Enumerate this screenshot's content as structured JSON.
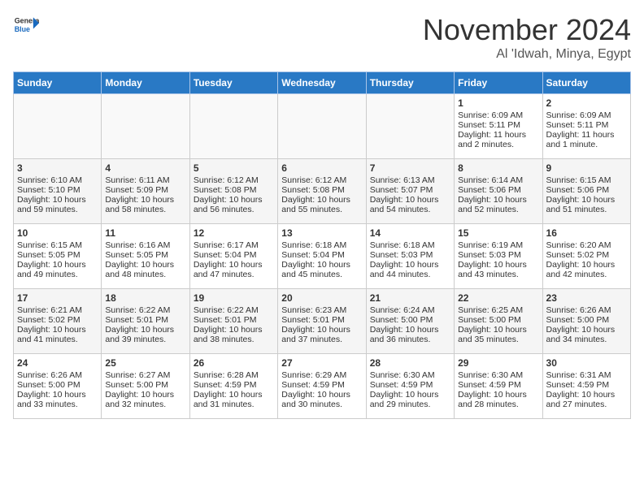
{
  "header": {
    "logo_general": "General",
    "logo_blue": "Blue",
    "month_title": "November 2024",
    "location": "Al 'Idwah, Minya, Egypt"
  },
  "days_of_week": [
    "Sunday",
    "Monday",
    "Tuesday",
    "Wednesday",
    "Thursday",
    "Friday",
    "Saturday"
  ],
  "weeks": [
    [
      {
        "day": "",
        "data": ""
      },
      {
        "day": "",
        "data": ""
      },
      {
        "day": "",
        "data": ""
      },
      {
        "day": "",
        "data": ""
      },
      {
        "day": "",
        "data": ""
      },
      {
        "day": "1",
        "data": "Sunrise: 6:09 AM\nSunset: 5:11 PM\nDaylight: 11 hours and 2 minutes."
      },
      {
        "day": "2",
        "data": "Sunrise: 6:09 AM\nSunset: 5:11 PM\nDaylight: 11 hours and 1 minute."
      }
    ],
    [
      {
        "day": "3",
        "data": "Sunrise: 6:10 AM\nSunset: 5:10 PM\nDaylight: 10 hours and 59 minutes."
      },
      {
        "day": "4",
        "data": "Sunrise: 6:11 AM\nSunset: 5:09 PM\nDaylight: 10 hours and 58 minutes."
      },
      {
        "day": "5",
        "data": "Sunrise: 6:12 AM\nSunset: 5:08 PM\nDaylight: 10 hours and 56 minutes."
      },
      {
        "day": "6",
        "data": "Sunrise: 6:12 AM\nSunset: 5:08 PM\nDaylight: 10 hours and 55 minutes."
      },
      {
        "day": "7",
        "data": "Sunrise: 6:13 AM\nSunset: 5:07 PM\nDaylight: 10 hours and 54 minutes."
      },
      {
        "day": "8",
        "data": "Sunrise: 6:14 AM\nSunset: 5:06 PM\nDaylight: 10 hours and 52 minutes."
      },
      {
        "day": "9",
        "data": "Sunrise: 6:15 AM\nSunset: 5:06 PM\nDaylight: 10 hours and 51 minutes."
      }
    ],
    [
      {
        "day": "10",
        "data": "Sunrise: 6:15 AM\nSunset: 5:05 PM\nDaylight: 10 hours and 49 minutes."
      },
      {
        "day": "11",
        "data": "Sunrise: 6:16 AM\nSunset: 5:05 PM\nDaylight: 10 hours and 48 minutes."
      },
      {
        "day": "12",
        "data": "Sunrise: 6:17 AM\nSunset: 5:04 PM\nDaylight: 10 hours and 47 minutes."
      },
      {
        "day": "13",
        "data": "Sunrise: 6:18 AM\nSunset: 5:04 PM\nDaylight: 10 hours and 45 minutes."
      },
      {
        "day": "14",
        "data": "Sunrise: 6:18 AM\nSunset: 5:03 PM\nDaylight: 10 hours and 44 minutes."
      },
      {
        "day": "15",
        "data": "Sunrise: 6:19 AM\nSunset: 5:03 PM\nDaylight: 10 hours and 43 minutes."
      },
      {
        "day": "16",
        "data": "Sunrise: 6:20 AM\nSunset: 5:02 PM\nDaylight: 10 hours and 42 minutes."
      }
    ],
    [
      {
        "day": "17",
        "data": "Sunrise: 6:21 AM\nSunset: 5:02 PM\nDaylight: 10 hours and 41 minutes."
      },
      {
        "day": "18",
        "data": "Sunrise: 6:22 AM\nSunset: 5:01 PM\nDaylight: 10 hours and 39 minutes."
      },
      {
        "day": "19",
        "data": "Sunrise: 6:22 AM\nSunset: 5:01 PM\nDaylight: 10 hours and 38 minutes."
      },
      {
        "day": "20",
        "data": "Sunrise: 6:23 AM\nSunset: 5:01 PM\nDaylight: 10 hours and 37 minutes."
      },
      {
        "day": "21",
        "data": "Sunrise: 6:24 AM\nSunset: 5:00 PM\nDaylight: 10 hours and 36 minutes."
      },
      {
        "day": "22",
        "data": "Sunrise: 6:25 AM\nSunset: 5:00 PM\nDaylight: 10 hours and 35 minutes."
      },
      {
        "day": "23",
        "data": "Sunrise: 6:26 AM\nSunset: 5:00 PM\nDaylight: 10 hours and 34 minutes."
      }
    ],
    [
      {
        "day": "24",
        "data": "Sunrise: 6:26 AM\nSunset: 5:00 PM\nDaylight: 10 hours and 33 minutes."
      },
      {
        "day": "25",
        "data": "Sunrise: 6:27 AM\nSunset: 5:00 PM\nDaylight: 10 hours and 32 minutes."
      },
      {
        "day": "26",
        "data": "Sunrise: 6:28 AM\nSunset: 4:59 PM\nDaylight: 10 hours and 31 minutes."
      },
      {
        "day": "27",
        "data": "Sunrise: 6:29 AM\nSunset: 4:59 PM\nDaylight: 10 hours and 30 minutes."
      },
      {
        "day": "28",
        "data": "Sunrise: 6:30 AM\nSunset: 4:59 PM\nDaylight: 10 hours and 29 minutes."
      },
      {
        "day": "29",
        "data": "Sunrise: 6:30 AM\nSunset: 4:59 PM\nDaylight: 10 hours and 28 minutes."
      },
      {
        "day": "30",
        "data": "Sunrise: 6:31 AM\nSunset: 4:59 PM\nDaylight: 10 hours and 27 minutes."
      }
    ]
  ]
}
